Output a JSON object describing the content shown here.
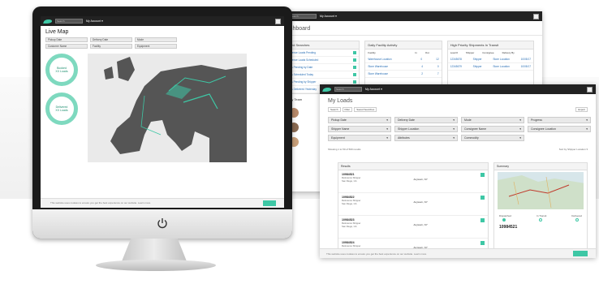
{
  "colors": {
    "accent": "#3ec7a5",
    "topbar": "#222222",
    "map_land": "#555555",
    "map_sea": "#eaeaea"
  },
  "monitor": {
    "search_placeholder": "Search",
    "account_menu": "My Account ▾",
    "avatar_label": "",
    "page_title": "Live Map",
    "filters": [
      "Pickup Date",
      "Delivery Date",
      "Mode",
      "Customer Name",
      "Facility",
      "Equipment"
    ],
    "dials": [
      {
        "label": "Booked",
        "value": "XX Loads"
      },
      {
        "label": "Delivered",
        "value": "XX Loads"
      }
    ],
    "footer_text": "This website uses cookies to ensure you get the best experience on our website. Learn more",
    "footer_button": "Got it"
  },
  "dashboard": {
    "search_placeholder": "Search",
    "account_menu": "My Account ▾",
    "title": "Dashboard",
    "saved_searches": {
      "title": "Saved Searches",
      "items": [
        "Reference Loads Pending",
        "Reference Loads Scheduled",
        "Loads Pending by Date",
        "Loads Scheduled Today",
        "Loads Pending by Shipper",
        "Loads Delivered Yesterday"
      ]
    },
    "facility_activity": {
      "title": "Daily Facility Activity",
      "headers": [
        "Facility",
        "In",
        "Out"
      ],
      "rows": [
        [
          "Warehouse Location",
          "0",
          "12"
        ],
        [
          "Store Warehouse",
          "4",
          "0"
        ],
        [
          "Store Warehouse",
          "2",
          "7"
        ]
      ]
    },
    "priority": {
      "title": "High Priority Shipments In Transit",
      "headers": [
        "Load #",
        "Shipper",
        "Consignee",
        "Delivery By"
      ],
      "rows": [
        [
          "12345678",
          "Shipper",
          "Store Location",
          "10/05/17"
        ],
        [
          "12345679",
          "Shipper",
          "Store Location",
          "10/05/17"
        ]
      ]
    },
    "team_title": "My Team"
  },
  "loads": {
    "search_placeholder": "Search",
    "account_menu": "My Account ▾",
    "title": "My Loads",
    "toolbar": [
      "Search",
      "Filter",
      "Saved Searches",
      "Export"
    ],
    "filters": [
      "Pickup Date",
      "Delivery Date",
      "Mode",
      "Progress",
      "Shipper Name",
      "Shipper Location",
      "Consignee Name",
      "Consignee Location",
      "Equipment",
      "Attributes",
      "Commodity"
    ],
    "showing": "Showing 1 to 50 of 500 results",
    "sort": "Sort by Shipper Location ▾",
    "results_title": "Results",
    "summary_title": "Summary",
    "results": [
      {
        "id": "10984521",
        "shipper": "Reference Shipper",
        "city": "San Diego, CA",
        "mid": "Anytown, NY"
      },
      {
        "id": "10984522",
        "shipper": "Reference Shipper",
        "city": "San Diego, CA",
        "mid": "Anytown, NY"
      },
      {
        "id": "10984523",
        "shipper": "Reference Shipper",
        "city": "San Diego, CA",
        "mid": "Anytown, NY"
      },
      {
        "id": "10984524",
        "shipper": "Reference Shipper",
        "city": "San Diego, CA",
        "mid": "Anytown, NY"
      }
    ],
    "stages": [
      "Dispatched",
      "In Transit",
      "Delivered"
    ],
    "summary_id": "10984521",
    "footer_text": "This website uses cookies to ensure you get the best experience on our website. Learn more",
    "footer_button": "Got it"
  }
}
